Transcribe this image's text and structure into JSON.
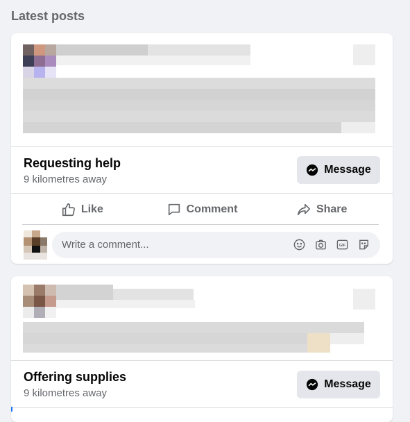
{
  "section": {
    "title": "Latest posts"
  },
  "posts": [
    {
      "title": "Requesting help",
      "distance": "9 kilometres away",
      "message_label": "Message",
      "actions": {
        "like": "Like",
        "comment": "Comment",
        "share": "Share"
      },
      "comment_placeholder": "Write a comment..."
    },
    {
      "title": "Offering supplies",
      "distance": "9 kilometres away",
      "message_label": "Message"
    }
  ],
  "icons": {
    "message": "messenger-icon",
    "like": "thumbs-up-icon",
    "comment": "speech-bubble-icon",
    "share": "share-arrow-icon",
    "emoji": "smiley-icon",
    "camera": "camera-icon",
    "gif": "gif-icon",
    "sticker": "sticker-icon"
  },
  "colors": {
    "background": "#f0f2f5",
    "card": "#ffffff",
    "secondary_text": "#65676b",
    "button_bg": "#e4e6eb",
    "accent": "#1877f2"
  }
}
